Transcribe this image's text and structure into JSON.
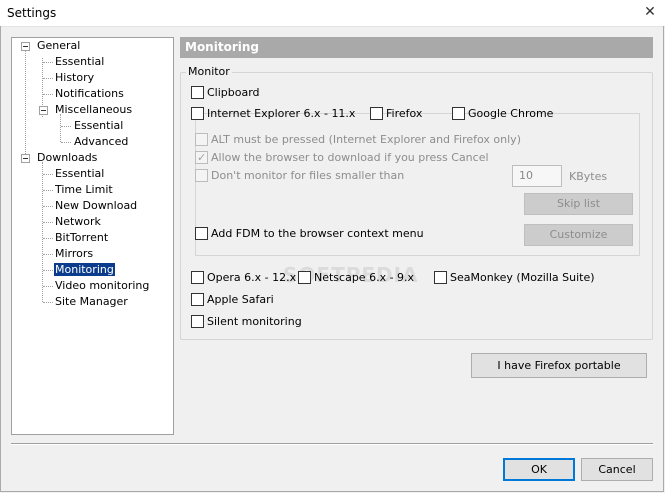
{
  "window": {
    "title": "Settings",
    "close_glyph": "✕"
  },
  "tree": {
    "general": "General",
    "general_children": [
      "Essential",
      "History",
      "Notifications"
    ],
    "misc": "Miscellaneous",
    "misc_children": [
      "Essential",
      "Advanced"
    ],
    "downloads": "Downloads",
    "downloads_children": [
      "Essential",
      "Time Limit",
      "New Download",
      "Network",
      "BitTorrent",
      "Mirrors",
      "Monitoring",
      "Video monitoring",
      "Site Manager"
    ],
    "selected": "Monitoring"
  },
  "panel": {
    "header": "Monitoring",
    "group_label": "Monitor",
    "clipboard": "Clipboard",
    "ie": "Internet Explorer 6.x - 11.x",
    "firefox": "Firefox",
    "chrome": "Google Chrome",
    "alt_pressed": "ALT must be pressed (Internet Explorer and Firefox only)",
    "allow_cancel": "Allow the browser to download if you press Cancel",
    "dont_monitor": "Don't monitor for files smaller than",
    "size_value": "10",
    "size_unit": "KBytes",
    "skip_list": "Skip list",
    "add_context": "Add FDM to the browser context menu",
    "customize": "Customize",
    "opera": "Opera 6.x - 12.x",
    "netscape": "Netscape 6.x - 9.x",
    "seamonkey": "SeaMonkey (Mozilla Suite)",
    "safari": "Apple Safari",
    "silent": "Silent monitoring",
    "portable_button": "I have Firefox portable"
  },
  "footer": {
    "ok": "OK",
    "cancel": "Cancel"
  },
  "watermark": "SOFTPEDIA",
  "colors": {
    "selection": "#0a3b8c",
    "header_bg": "#a9a9a9",
    "accent": "#0078d7"
  }
}
